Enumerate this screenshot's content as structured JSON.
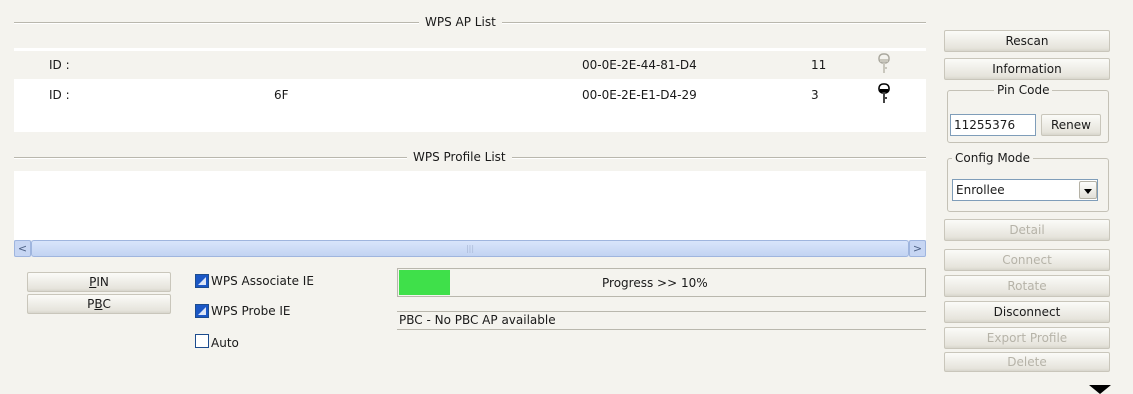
{
  "ap_list": {
    "caption": "WPS AP List",
    "rows": [
      {
        "id_label": "ID :",
        "ssid": "",
        "bssid": "00-0E-2E-44-81-D4",
        "channel": "11",
        "icon": "key-icon-grey"
      },
      {
        "id_label": "ID :",
        "ssid": "6F",
        "bssid": "00-0E-2E-E1-D4-29",
        "channel": "3",
        "icon": "key-icon-black"
      }
    ]
  },
  "profile_list": {
    "caption": "WPS Profile List",
    "scrollbar": {
      "left": "<",
      "right": ">",
      "thumb": "|||"
    }
  },
  "buttons": {
    "pin": {
      "before": "",
      "accel": "P",
      "after": "IN"
    },
    "pbc": {
      "before": "P",
      "accel": "B",
      "after": "C"
    }
  },
  "options": {
    "associate_ie": {
      "label": "WPS Associate IE",
      "checked": true
    },
    "probe_ie": {
      "label": "WPS Probe IE",
      "checked": true
    },
    "auto": {
      "label": "Auto",
      "checked": false
    }
  },
  "progress": {
    "text": "Progress >> 10%",
    "percent": 10,
    "color": "#3fe04a"
  },
  "status": "PBC - No PBC AP available",
  "side": {
    "rescan": "Rescan",
    "information": "Information",
    "pin_code_caption": "Pin Code",
    "pin_code_value": "11255376",
    "renew": "Renew",
    "config_mode_caption": "Config Mode",
    "config_mode_value": "Enrollee",
    "detail": "Detail",
    "connect": "Connect",
    "rotate": "Rotate",
    "disconnect": "Disconnect",
    "export_profile": "Export Profile",
    "delete": "Delete"
  }
}
